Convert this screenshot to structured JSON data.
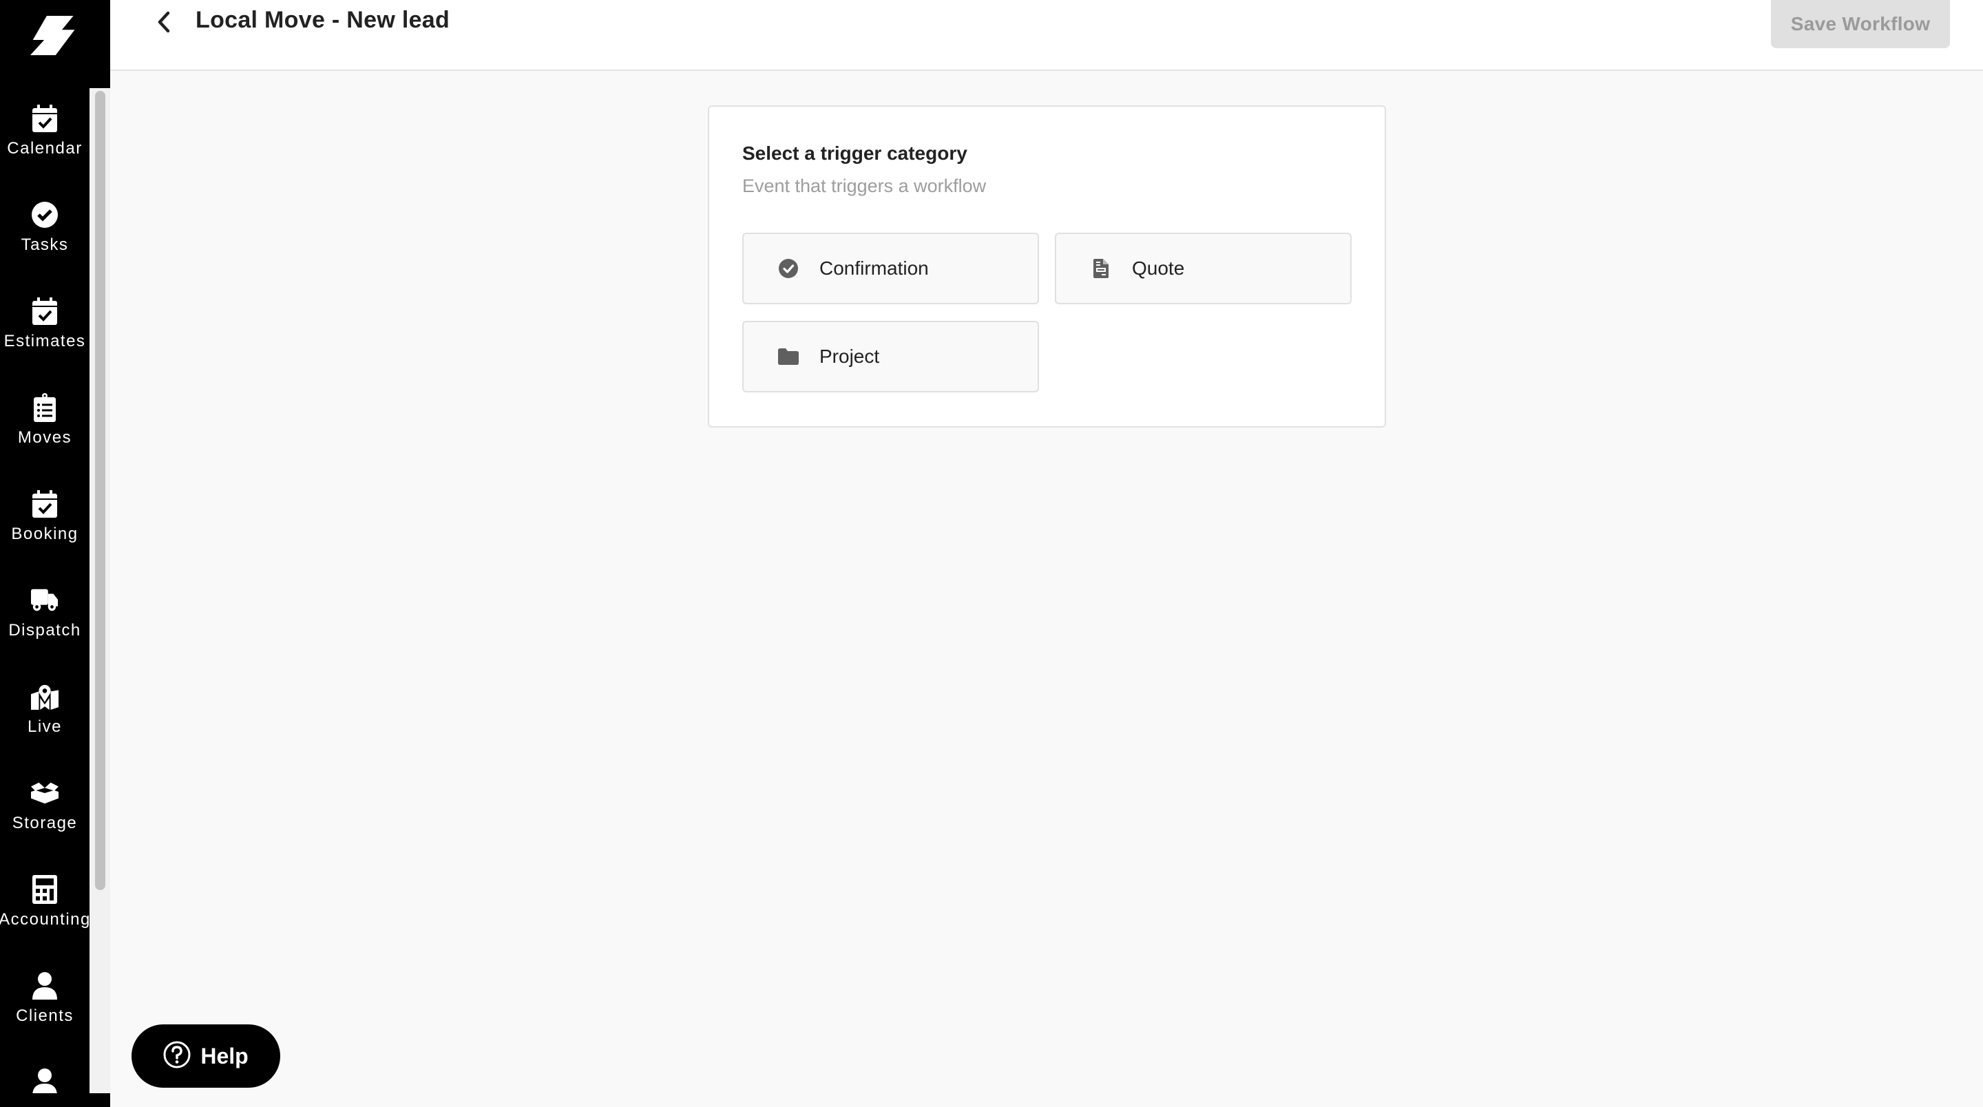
{
  "header": {
    "title": "Local Move - New lead",
    "back_icon": "chevron-left-icon",
    "save_label": "Save Workflow"
  },
  "sidebar": {
    "logo": "lightning-logo",
    "items": [
      {
        "label": "Calendar",
        "icon": "calendar-check-icon"
      },
      {
        "label": "Tasks",
        "icon": "check-circle-icon"
      },
      {
        "label": "Estimates",
        "icon": "calendar-check-icon"
      },
      {
        "label": "Moves",
        "icon": "clipboard-list-icon"
      },
      {
        "label": "Booking",
        "icon": "calendar-check-icon"
      },
      {
        "label": "Dispatch",
        "icon": "truck-icon"
      },
      {
        "label": "Live",
        "icon": "map-pin-icon"
      },
      {
        "label": "Storage",
        "icon": "box-open-icon"
      },
      {
        "label": "Accounting",
        "icon": "calculator-icon"
      },
      {
        "label": "Clients",
        "icon": "user-icon"
      },
      {
        "label": "",
        "icon": "user-icon"
      }
    ]
  },
  "card": {
    "title": "Select a trigger category",
    "subtitle": "Event that triggers a workflow",
    "options": [
      {
        "label": "Confirmation",
        "icon": "check-circle-icon"
      },
      {
        "label": "Quote",
        "icon": "document-icon"
      },
      {
        "label": "Project",
        "icon": "folder-icon"
      }
    ]
  },
  "help": {
    "label": "Help",
    "icon": "question-circle-icon"
  },
  "colors": {
    "sidebar_bg": "#000000",
    "page_bg": "#f9f9f9",
    "save_disabled_bg": "#e0e0e0",
    "save_disabled_text": "#9a9a9a",
    "option_icon": "#5f5f5f"
  }
}
